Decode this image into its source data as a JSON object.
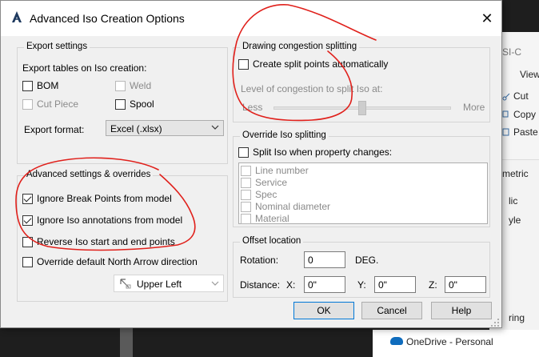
{
  "dialog": {
    "title": "Advanced Iso Creation Options",
    "close_glyph": "✕"
  },
  "export_settings": {
    "legend": "Export settings",
    "tables_label": "Export tables on Iso creation:",
    "bom": {
      "label": "BOM",
      "checked": false,
      "enabled": true
    },
    "weld": {
      "label": "Weld",
      "checked": false,
      "enabled": false
    },
    "cut_piece": {
      "label": "Cut Piece",
      "checked": false,
      "enabled": false
    },
    "spool": {
      "label": "Spool",
      "checked": false,
      "enabled": true
    },
    "format_label": "Export format:",
    "format_value": "Excel (.xlsx)"
  },
  "advanced_settings": {
    "legend": "Advanced settings & overrides",
    "ignore_break_points": {
      "label": "Ignore Break Points from model",
      "checked": true
    },
    "ignore_annotations": {
      "label": "Ignore Iso annotations from model",
      "checked": true
    },
    "reverse_iso": {
      "label": "Reverse Iso start and end points",
      "checked": false
    },
    "override_north_arrow": {
      "label": "Override default North Arrow direction",
      "checked": false
    },
    "north_arrow_value": "Upper Left"
  },
  "drawing_congestion": {
    "legend": "Drawing congestion splitting",
    "create_split": {
      "label": "Create split points automatically",
      "checked": false
    },
    "level_label": "Level of congestion to split Iso at:",
    "less_label": "Less",
    "more_label": "More",
    "slider_level": 0.5
  },
  "override_splitting": {
    "legend": "Override Iso splitting",
    "split_property": {
      "label": "Split Iso when property changes:",
      "checked": false
    },
    "properties": [
      "Line number",
      "Service",
      "Spec",
      "Nominal diameter",
      "Material"
    ]
  },
  "offset_location": {
    "legend": "Offset location",
    "rotation_label": "Rotation:",
    "rotation_value": "0",
    "rotation_unit": "DEG.",
    "distance_label": "Distance:",
    "x_label": "X:",
    "x_value": "0\"",
    "y_label": "Y:",
    "y_value": "0\"",
    "z_label": "Z:",
    "z_value": "0\""
  },
  "buttons": {
    "ok": "OK",
    "cancel": "Cancel",
    "help": "Help"
  },
  "background": {
    "items": [
      "SI-C",
      "View",
      "Cut",
      "Copy p",
      "Paste s",
      "metric",
      "lic",
      "yle",
      "ring"
    ],
    "onedrive_label": "OneDrive - Personal"
  },
  "colors": {
    "annotation_red": "#e0201b",
    "onedrive_blue": "#0f6cbd",
    "dialog_bg": "#f0f0f0"
  }
}
